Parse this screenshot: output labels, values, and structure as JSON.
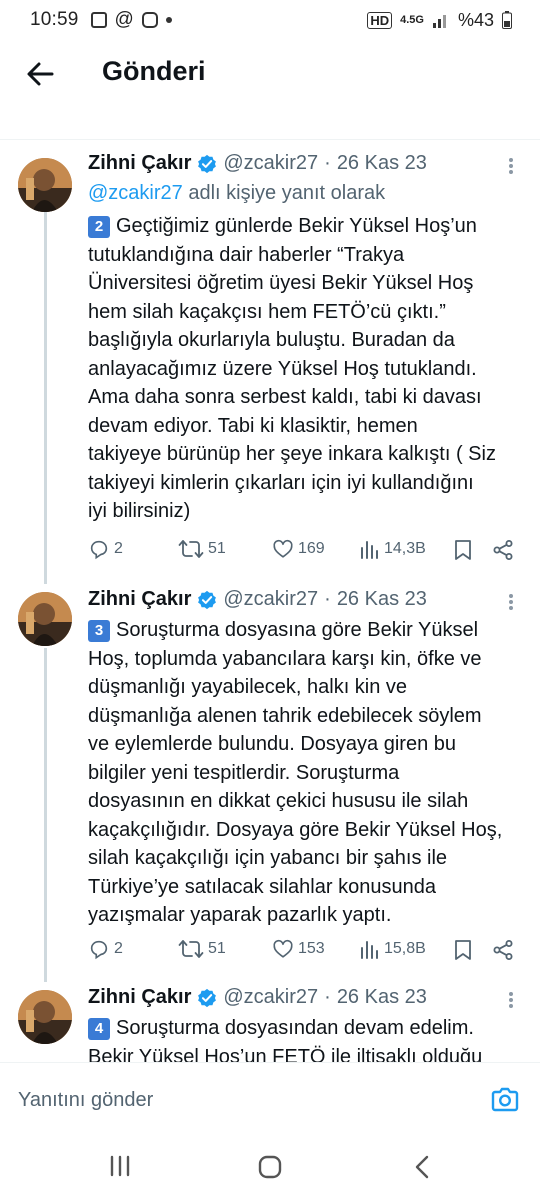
{
  "status_bar": {
    "time": "10:59",
    "left_icons": [
      "gallery-icon",
      "at-icon",
      "instagram-icon",
      "dot-icon"
    ],
    "network": "4.5G",
    "battery": "%43"
  },
  "header": {
    "title": "Gönderi",
    "back_icon": "arrow-left-icon"
  },
  "tweets": [
    {
      "name": "Zihni Çakır",
      "handle": "@zcakir27",
      "separator": "·",
      "date": "26 Kas 23",
      "reply_to_handle": "@zcakir27",
      "reply_to_suffix": "adlı kişiye yanıt olarak",
      "number": "2",
      "lines": [
        "Geçtiğimiz günlerde Bekir Yüksel Hoş’un",
        "tutuklandığına dair haberler “Trakya",
        "Üniversitesi öğretim üyesi Bekir Yüksel Hoş",
        "hem silah kaçakçısı hem FETÖ’cü çıktı.”",
        "başlığıyla okurlarıyla buluştu. Buradan da",
        "anlayacağımız üzere Yüksel Hoş tutuklandı.",
        "Ama daha sonra serbest kaldı, tabi ki davası",
        "devam ediyor. Tabi ki klasiktir, hemen",
        "takiyeye bürünüp her şeye inkara kalkıştı ( Siz",
        "takiyeyi kimlerin çıkarları için iyi kullandığını",
        "iyi bilirsiniz)"
      ],
      "replies": "2",
      "retweets": "51",
      "likes": "169",
      "views": "14,3B"
    },
    {
      "name": "Zihni Çakır",
      "handle": "@zcakir27",
      "separator": "·",
      "date": "26 Kas 23",
      "number": "3",
      "lines": [
        "Soruşturma dosyasına göre Bekir Yüksel",
        "Hoş, toplumda yabancılara karşı kin, öfke ve",
        "düşmanlığı yayabilecek, halkı kin ve",
        "düşmanlığa alenen tahrik edebilecek söylem",
        "ve eylemlerde bulundu. Dosyaya giren bu",
        "bilgiler yeni tespitlerdir. Soruşturma",
        "dosyasının en dikkat çekici hususu ile silah",
        "kaçakçılığıdır. Dosyaya göre Bekir Yüksel Hoş,",
        "silah kaçakçılığı için yabancı bir şahıs ile",
        "Türkiye’ye satılacak silahlar konusunda",
        "yazışmalar yaparak pazarlık yaptı."
      ],
      "replies": "2",
      "retweets": "51",
      "likes": "153",
      "views": "15,8B"
    },
    {
      "name": "Zihni Çakır",
      "handle": "@zcakir27",
      "separator": "·",
      "date": "26 Kas 23",
      "number": "4",
      "lines": [
        "Soruşturma dosyasından devam edelim.",
        "Bekir Yüksel Hoş’un FETÖ ile iltisaklı olduğu"
      ]
    }
  ],
  "reply_bar": {
    "placeholder": "Yanıtını gönder",
    "camera_icon": "camera-icon"
  },
  "nav_bar": {
    "icons": [
      "recent-apps-icon",
      "home-icon",
      "back-icon"
    ]
  },
  "colors": {
    "accent": "#1d9bf0",
    "secondary_text": "#536471",
    "badge": "#3a7bd5"
  }
}
